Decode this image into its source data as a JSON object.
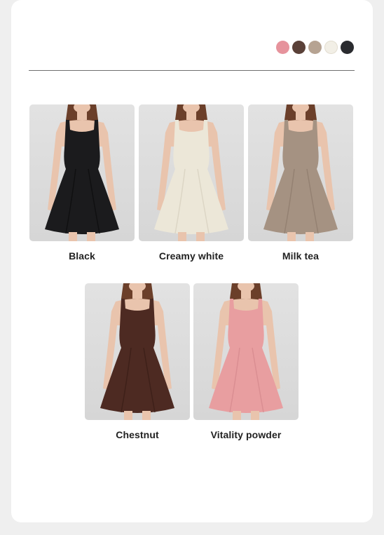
{
  "swatches": [
    {
      "name": "pink-swatch",
      "color": "#e6939c"
    },
    {
      "name": "brown-swatch",
      "color": "#5a4038"
    },
    {
      "name": "taupe-swatch",
      "color": "#b6a392"
    },
    {
      "name": "cream-swatch",
      "color": "#f2efe6"
    },
    {
      "name": "black-swatch",
      "color": "#2a2b2f"
    }
  ],
  "products": [
    {
      "label": "Black",
      "dress": "#1b1b1d",
      "shade": "#0c0c0d"
    },
    {
      "label": "Creamy white",
      "dress": "#ece7d8",
      "shade": "#d6cfbd"
    },
    {
      "label": "Milk tea",
      "dress": "#a59282",
      "shade": "#8d7a6b"
    },
    {
      "label": "Chestnut",
      "dress": "#4d2a22",
      "shade": "#371c16"
    },
    {
      "label": "Vitality powder",
      "dress": "#e89ea0",
      "shade": "#d4888b"
    }
  ]
}
